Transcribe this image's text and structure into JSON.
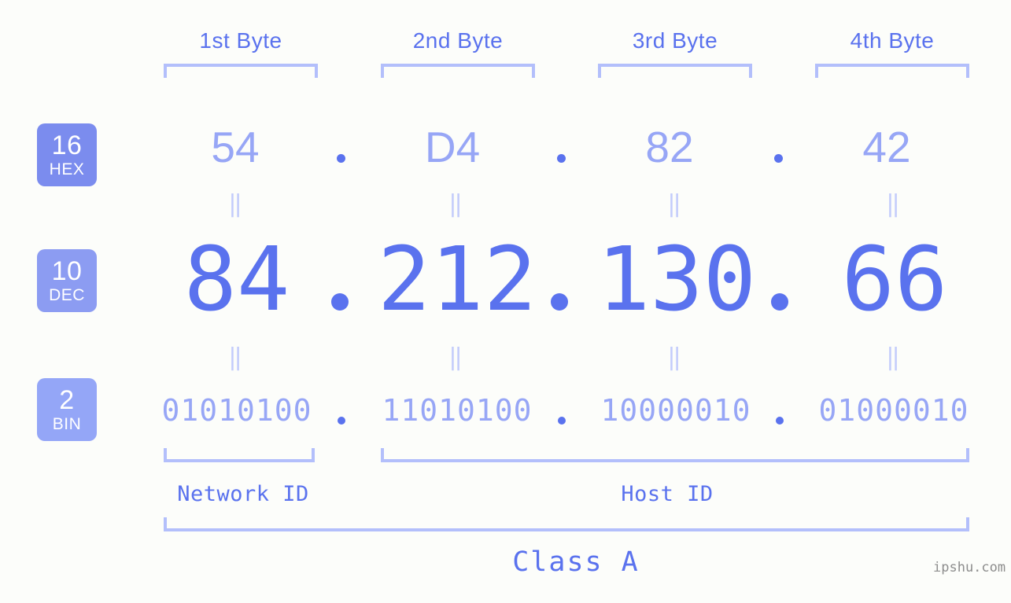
{
  "meta": {
    "watermark": "ipshu.com",
    "background_color": "#fcfdfa",
    "accent_color": "#5a72ee",
    "light_accent_color": "#97a6f6",
    "bracket_color": "#b3bffb",
    "connector_color": "#c3ccfb"
  },
  "headers": [
    {
      "label": "1st Byte"
    },
    {
      "label": "2nd Byte"
    },
    {
      "label": "3rd Byte"
    },
    {
      "label": "4th Byte"
    }
  ],
  "bases": [
    {
      "number": "16",
      "abbr": "HEX",
      "color": "#7b8cee"
    },
    {
      "number": "10",
      "abbr": "DEC",
      "color": "#8c9cf2"
    },
    {
      "number": "2",
      "abbr": "BIN",
      "color": "#94a6f7"
    }
  ],
  "rows": {
    "hex": {
      "values": [
        "54",
        "D4",
        "82",
        "42"
      ],
      "separator": "."
    },
    "dec": {
      "values": [
        "84",
        "212",
        "130",
        "66"
      ],
      "separator": "."
    },
    "bin": {
      "values": [
        "01010100",
        "11010100",
        "10000010",
        "01000010"
      ],
      "separator": "."
    }
  },
  "connectors": {
    "symbol": "‖",
    "rows": [
      "hex-to-dec",
      "dec-to-bin"
    ]
  },
  "segments": {
    "network_id": "Network ID",
    "host_id": "Host ID",
    "class": "Class A"
  }
}
